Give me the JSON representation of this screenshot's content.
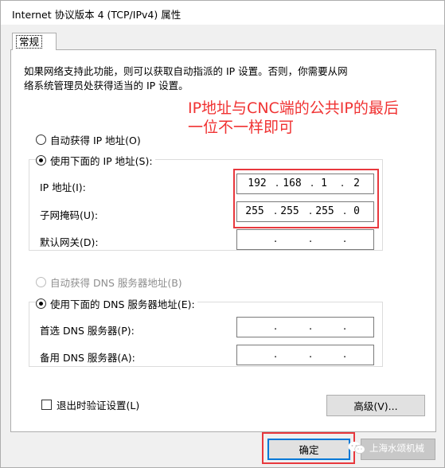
{
  "window": {
    "title": "Internet 协议版本 4 (TCP/IPv4) 属性"
  },
  "tab": {
    "label": "常规"
  },
  "description": {
    "line1": "如果网络支持此功能，则可以获取自动指派的 IP 设置。否则，你需要从网",
    "line2": "络系统管理员处获得适当的 IP 设置。"
  },
  "annotation": {
    "line1": "IP地址与CNC端的公共IP的最后",
    "line2": "一位不一样即可",
    "color": "#f03232"
  },
  "ip_mode": {
    "auto_label": "自动获得 IP 地址(O)",
    "manual_label": "使用下面的 IP 地址(S):",
    "selected": "manual"
  },
  "ip_fields": {
    "ip_label": "IP 地址(I):",
    "ip_value": [
      "192",
      "168",
      "1",
      "2"
    ],
    "mask_label": "子网掩码(U):",
    "mask_value": [
      "255",
      "255",
      "255",
      "0"
    ],
    "gateway_label": "默认网关(D):",
    "gateway_value": [
      "",
      "",
      "",
      ""
    ]
  },
  "dns_mode": {
    "auto_label": "自动获得 DNS 服务器地址(B)",
    "manual_label": "使用下面的 DNS 服务器地址(E):",
    "selected": "manual"
  },
  "dns_fields": {
    "preferred_label": "首选 DNS 服务器(P):",
    "preferred_value": [
      "",
      "",
      "",
      ""
    ],
    "alternate_label": "备用 DNS 服务器(A):",
    "alternate_value": [
      "",
      "",
      "",
      ""
    ]
  },
  "validate": {
    "label": "退出时验证设置(L)",
    "checked": false
  },
  "buttons": {
    "advanced": "高级(V)...",
    "ok": "确定"
  },
  "watermark": {
    "text": "上海水颂机械"
  },
  "colors": {
    "highlight": "#e8383d",
    "accent": "#0078d7"
  }
}
